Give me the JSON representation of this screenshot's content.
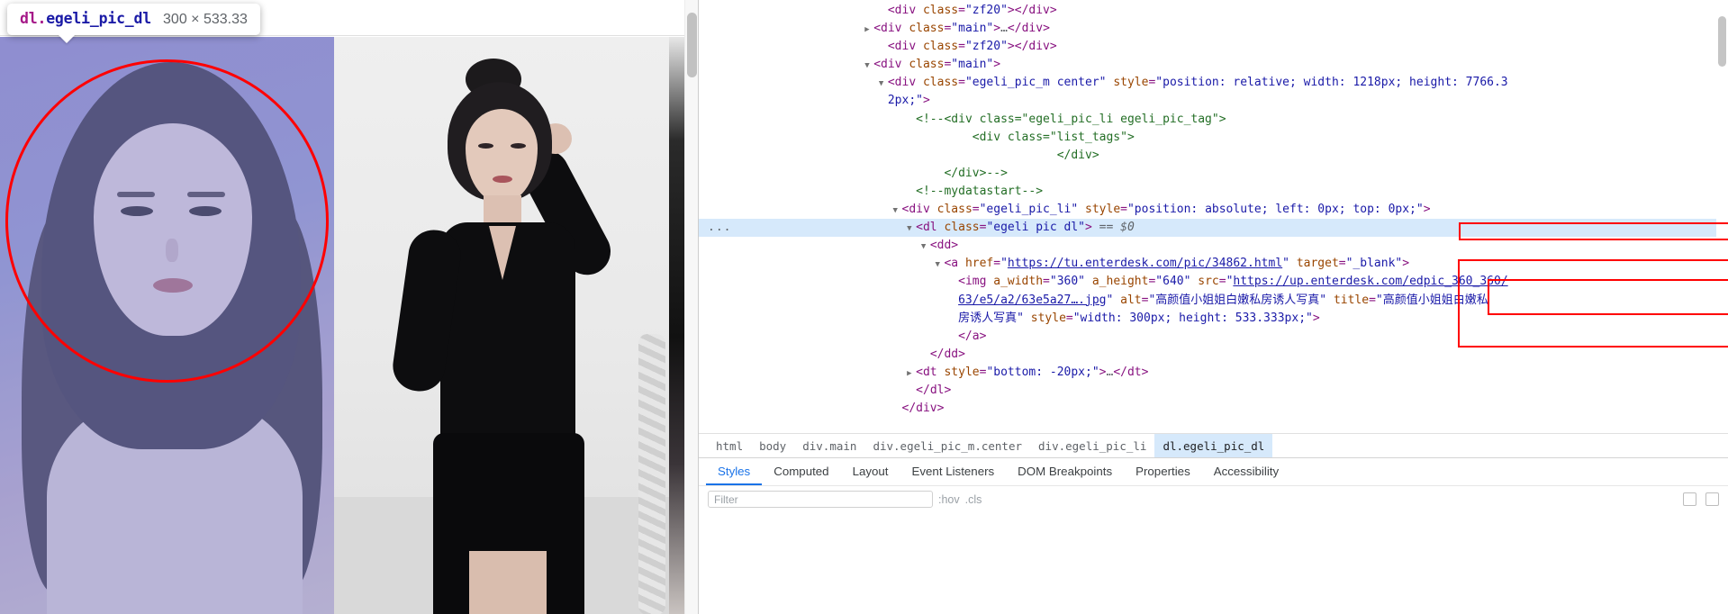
{
  "element_tooltip": {
    "tag_part": "dl.",
    "class_part": "egeli_pic_dl",
    "dimensions": "300 × 533.33"
  },
  "colors": {
    "selection_blue": "#d6e9fb",
    "annotation_red": "#ff0000",
    "tag_purple": "#881280",
    "attr_orange": "#994500",
    "value_blue": "#1a1aa8",
    "comment_green": "#236e25",
    "active_tab_blue": "#1a73e8"
  },
  "dom_rows": [
    {
      "indent": 4,
      "twisty": "none",
      "segments": [
        {
          "t": "ang",
          "v": "<"
        },
        {
          "t": "tag",
          "v": "div"
        },
        {
          "t": "txt",
          "v": " "
        },
        {
          "t": "attr",
          "v": "class"
        },
        {
          "t": "eq",
          "v": "="
        },
        {
          "t": "val",
          "v": "\"zf20\""
        },
        {
          "t": "ang",
          "v": "></"
        },
        {
          "t": "tag",
          "v": "div"
        },
        {
          "t": "ang",
          "v": ">"
        }
      ]
    },
    {
      "indent": 3,
      "twisty": "closed",
      "segments": [
        {
          "t": "ang",
          "v": "<"
        },
        {
          "t": "tag",
          "v": "div"
        },
        {
          "t": "txt",
          "v": " "
        },
        {
          "t": "attr",
          "v": "class"
        },
        {
          "t": "eq",
          "v": "="
        },
        {
          "t": "val",
          "v": "\"main\""
        },
        {
          "t": "ang",
          "v": ">"
        },
        {
          "t": "ellip",
          "v": "…"
        },
        {
          "t": "ang",
          "v": "</"
        },
        {
          "t": "tag",
          "v": "div"
        },
        {
          "t": "ang",
          "v": ">"
        }
      ]
    },
    {
      "indent": 4,
      "twisty": "none",
      "segments": [
        {
          "t": "ang",
          "v": "<"
        },
        {
          "t": "tag",
          "v": "div"
        },
        {
          "t": "txt",
          "v": " "
        },
        {
          "t": "attr",
          "v": "class"
        },
        {
          "t": "eq",
          "v": "="
        },
        {
          "t": "val",
          "v": "\"zf20\""
        },
        {
          "t": "ang",
          "v": "></"
        },
        {
          "t": "tag",
          "v": "div"
        },
        {
          "t": "ang",
          "v": ">"
        }
      ]
    },
    {
      "indent": 3,
      "twisty": "open",
      "segments": [
        {
          "t": "ang",
          "v": "<"
        },
        {
          "t": "tag",
          "v": "div"
        },
        {
          "t": "txt",
          "v": " "
        },
        {
          "t": "attr",
          "v": "class"
        },
        {
          "t": "eq",
          "v": "="
        },
        {
          "t": "val",
          "v": "\"main\""
        },
        {
          "t": "ang",
          "v": ">"
        }
      ]
    },
    {
      "indent": 4,
      "twisty": "open",
      "segments": [
        {
          "t": "ang",
          "v": "<"
        },
        {
          "t": "tag",
          "v": "div"
        },
        {
          "t": "txt",
          "v": " "
        },
        {
          "t": "attr",
          "v": "class"
        },
        {
          "t": "eq",
          "v": "="
        },
        {
          "t": "val",
          "v": "\"egeli_pic_m center\""
        },
        {
          "t": "txt",
          "v": " "
        },
        {
          "t": "attr",
          "v": "style"
        },
        {
          "t": "eq",
          "v": "="
        },
        {
          "t": "val",
          "v": "\"position: relative; width: 1218px; height: 7766.3"
        }
      ]
    },
    {
      "indent": 4,
      "twisty": "none",
      "segments": [
        {
          "t": "val",
          "v": "2px;"
        },
        {
          "t": "val",
          "v": "\""
        },
        {
          "t": "ang",
          "v": ">"
        }
      ]
    },
    {
      "indent": 6,
      "twisty": "none",
      "segments": [
        {
          "t": "cmt",
          "v": "<!--<div class=\"egeli_pic_li egeli_pic_tag\">"
        }
      ]
    },
    {
      "indent": 10,
      "twisty": "none",
      "segments": [
        {
          "t": "cmt",
          "v": "<div class=\"list_tags\">"
        }
      ]
    },
    {
      "indent": 16,
      "twisty": "none",
      "segments": [
        {
          "t": "cmt",
          "v": "</div>"
        }
      ]
    },
    {
      "indent": 8,
      "twisty": "none",
      "segments": [
        {
          "t": "cmt",
          "v": "</div>-->"
        }
      ]
    },
    {
      "indent": 6,
      "twisty": "none",
      "segments": [
        {
          "t": "cmt",
          "v": "<!--mydatastart-->"
        }
      ]
    },
    {
      "indent": 5,
      "twisty": "open",
      "segments": [
        {
          "t": "ang",
          "v": "<"
        },
        {
          "t": "tag",
          "v": "div"
        },
        {
          "t": "txt",
          "v": " "
        },
        {
          "t": "attr",
          "v": "class"
        },
        {
          "t": "eq",
          "v": "="
        },
        {
          "t": "val",
          "v": "\"egeli_pic_li\""
        },
        {
          "t": "txt",
          "v": " "
        },
        {
          "t": "attr",
          "v": "style"
        },
        {
          "t": "eq",
          "v": "="
        },
        {
          "t": "val",
          "v": "\"position: absolute; left: 0px; top: 0px;\""
        },
        {
          "t": "ang",
          "v": ">"
        }
      ]
    },
    {
      "indent": 6,
      "twisty": "open",
      "selected": true,
      "dots": "...",
      "segments": [
        {
          "t": "ang",
          "v": "<"
        },
        {
          "t": "tag",
          "v": "dl"
        },
        {
          "t": "txt",
          "v": " "
        },
        {
          "t": "attr",
          "v": "class"
        },
        {
          "t": "eq",
          "v": "="
        },
        {
          "t": "val",
          "v": "\"egeli pic dl\""
        },
        {
          "t": "ang",
          "v": ">"
        },
        {
          "t": "eqdollar",
          "v": " == $0"
        }
      ]
    },
    {
      "indent": 7,
      "twisty": "open",
      "segments": [
        {
          "t": "ang",
          "v": "<"
        },
        {
          "t": "tag",
          "v": "dd"
        },
        {
          "t": "ang",
          "v": ">"
        }
      ]
    },
    {
      "indent": 8,
      "twisty": "open",
      "segments": [
        {
          "t": "ang",
          "v": "<"
        },
        {
          "t": "tag",
          "v": "a"
        },
        {
          "t": "txt",
          "v": " "
        },
        {
          "t": "attr",
          "v": "href"
        },
        {
          "t": "eq",
          "v": "="
        },
        {
          "t": "val",
          "v": "\""
        },
        {
          "t": "lnk",
          "v": "https://tu.enterdesk.com/pic/34862.html"
        },
        {
          "t": "val",
          "v": "\""
        },
        {
          "t": "txt",
          "v": " "
        },
        {
          "t": "attr",
          "v": "target"
        },
        {
          "t": "eq",
          "v": "="
        },
        {
          "t": "val",
          "v": "\"_blank\""
        },
        {
          "t": "ang",
          "v": ">"
        }
      ]
    },
    {
      "indent": 9,
      "twisty": "none",
      "segments": [
        {
          "t": "ang",
          "v": "<"
        },
        {
          "t": "tag",
          "v": "img"
        },
        {
          "t": "txt",
          "v": " "
        },
        {
          "t": "attr",
          "v": "a_width"
        },
        {
          "t": "eq",
          "v": "="
        },
        {
          "t": "val",
          "v": "\"360\""
        },
        {
          "t": "txt",
          "v": " "
        },
        {
          "t": "attr",
          "v": "a_height"
        },
        {
          "t": "eq",
          "v": "="
        },
        {
          "t": "val",
          "v": "\"640\""
        },
        {
          "t": "txt",
          "v": " "
        },
        {
          "t": "attr",
          "v": "src"
        },
        {
          "t": "eq",
          "v": "="
        },
        {
          "t": "val",
          "v": "\""
        },
        {
          "t": "lnk",
          "v": "https://up.enterdesk.com/edpic_360_360/"
        }
      ]
    },
    {
      "indent": 9,
      "twisty": "none",
      "segments": [
        {
          "t": "lnk",
          "v": "63/e5/a2/63e5a27….jpg"
        },
        {
          "t": "val",
          "v": "\""
        },
        {
          "t": "txt",
          "v": " "
        },
        {
          "t": "attr",
          "v": "alt"
        },
        {
          "t": "eq",
          "v": "="
        },
        {
          "t": "val",
          "v": "\"高颜值小姐姐白嫩私房诱人写真\""
        },
        {
          "t": "txt",
          "v": " "
        },
        {
          "t": "attr",
          "v": "title"
        },
        {
          "t": "eq",
          "v": "="
        },
        {
          "t": "val",
          "v": "\"高颜值小姐姐白嫩私"
        }
      ]
    },
    {
      "indent": 9,
      "twisty": "none",
      "segments": [
        {
          "t": "val",
          "v": "房诱人写真\""
        },
        {
          "t": "txt",
          "v": " "
        },
        {
          "t": "attr",
          "v": "style"
        },
        {
          "t": "eq",
          "v": "="
        },
        {
          "t": "val",
          "v": "\"width: 300px; height: 533.333px;\""
        },
        {
          "t": "ang",
          "v": ">"
        }
      ]
    },
    {
      "indent": 9,
      "twisty": "none",
      "segments": [
        {
          "t": "ang",
          "v": "</"
        },
        {
          "t": "tag",
          "v": "a"
        },
        {
          "t": "ang",
          "v": ">"
        }
      ]
    },
    {
      "indent": 7,
      "twisty": "none",
      "segments": [
        {
          "t": "ang",
          "v": "</"
        },
        {
          "t": "tag",
          "v": "dd"
        },
        {
          "t": "ang",
          "v": ">"
        }
      ]
    },
    {
      "indent": 6,
      "twisty": "closed",
      "segments": [
        {
          "t": "ang",
          "v": "<"
        },
        {
          "t": "tag",
          "v": "dt"
        },
        {
          "t": "txt",
          "v": " "
        },
        {
          "t": "attr",
          "v": "style"
        },
        {
          "t": "eq",
          "v": "="
        },
        {
          "t": "val",
          "v": "\"bottom: -20px;\""
        },
        {
          "t": "ang",
          "v": ">"
        },
        {
          "t": "ellip",
          "v": "…"
        },
        {
          "t": "ang",
          "v": "</"
        },
        {
          "t": "tag",
          "v": "dt"
        },
        {
          "t": "ang",
          "v": ">"
        }
      ]
    },
    {
      "indent": 6,
      "twisty": "none",
      "segments": [
        {
          "t": "ang",
          "v": "</"
        },
        {
          "t": "tag",
          "v": "dl"
        },
        {
          "t": "ang",
          "v": ">"
        }
      ]
    },
    {
      "indent": 5,
      "twisty": "none",
      "segments": [
        {
          "t": "ang",
          "v": "</"
        },
        {
          "t": "tag",
          "v": "div"
        },
        {
          "t": "ang",
          "v": ">"
        }
      ]
    }
  ],
  "breadcrumb": [
    {
      "label": "html",
      "active": false
    },
    {
      "label": "body",
      "active": false
    },
    {
      "label": "div.main",
      "active": false
    },
    {
      "label": "div.egeli_pic_m.center",
      "active": false
    },
    {
      "label": "div.egeli_pic_li",
      "active": false
    },
    {
      "label": "dl.egeli_pic_dl",
      "active": true
    }
  ],
  "drawer_tabs": [
    {
      "label": "Styles",
      "active": true
    },
    {
      "label": "Computed",
      "active": false
    },
    {
      "label": "Layout",
      "active": false
    },
    {
      "label": "Event Listeners",
      "active": false
    },
    {
      "label": "DOM Breakpoints",
      "active": false
    },
    {
      "label": "Properties",
      "active": false
    },
    {
      "label": "Accessibility",
      "active": false
    }
  ],
  "styles_pane": {
    "filter_placeholder": "Filter",
    "hov_label": ":hov",
    "cls_label": ".cls"
  }
}
